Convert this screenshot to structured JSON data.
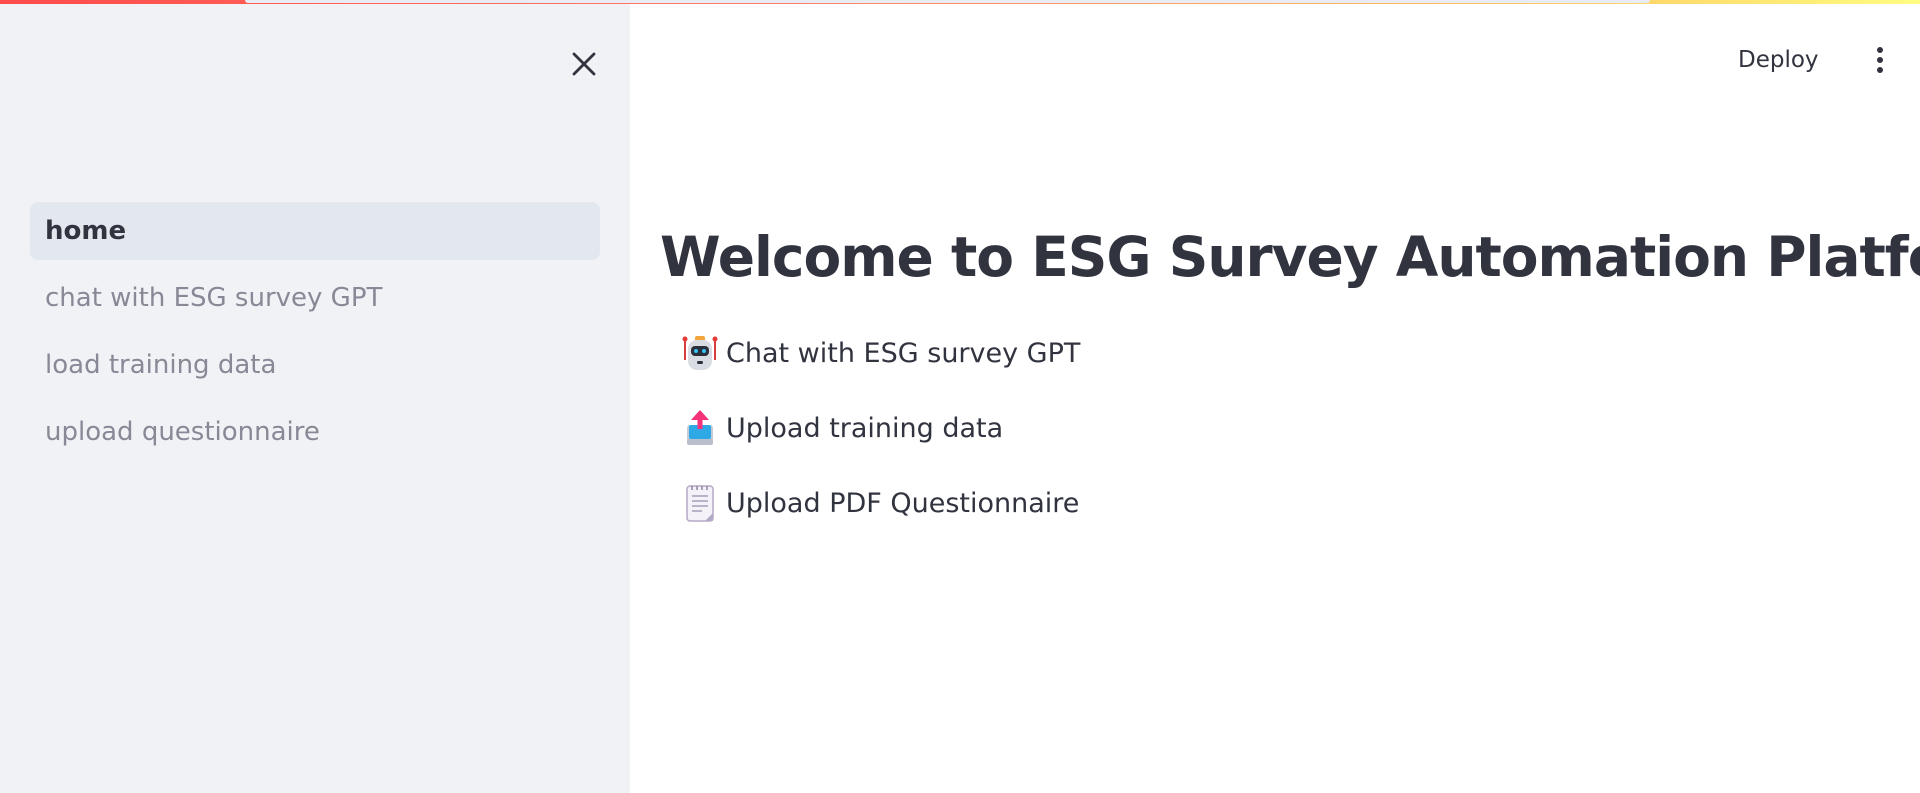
{
  "sidebar": {
    "items": [
      {
        "label": "home",
        "active": true
      },
      {
        "label": "chat with ESG survey GPT",
        "active": false
      },
      {
        "label": "load training data",
        "active": false
      },
      {
        "label": "upload questionnaire",
        "active": false
      }
    ],
    "close_icon": "close-icon"
  },
  "header": {
    "deploy_label": "Deploy",
    "menu_icon": "more-vertical-icon"
  },
  "main": {
    "title": "Welcome to ESG Survey Automation Platform",
    "links": [
      {
        "label": "Chat with ESG survey GPT",
        "icon": "robot-icon"
      },
      {
        "label": "Upload training data",
        "icon": "upload-tray-icon"
      },
      {
        "label": "Upload PDF Questionnaire",
        "icon": "notepad-icon"
      }
    ]
  },
  "colors": {
    "sidebar_bg": "#f0f2f6",
    "active_item_bg": "#e3e7ee",
    "text": "#31333f",
    "muted_text": "#878a96",
    "accent": "#ff4b4b"
  }
}
